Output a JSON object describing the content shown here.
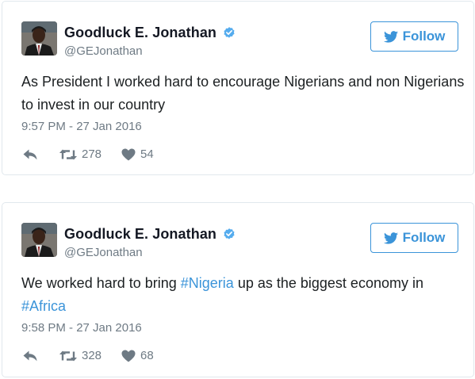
{
  "tweets": [
    {
      "display_name": "Goodluck E. Jonathan",
      "handle": "@GEJonathan",
      "follow_label": "Follow",
      "text_segments": [
        {
          "text": "As President I worked hard to encourage Nigerians and non Nigerians to invest in our country",
          "type": "text"
        }
      ],
      "timestamp": "9:57 PM - 27 Jan 2016",
      "retweets": "278",
      "likes": "54"
    },
    {
      "display_name": "Goodluck E. Jonathan",
      "handle": "@GEJonathan",
      "follow_label": "Follow",
      "text_segments": [
        {
          "text": "We worked hard to bring ",
          "type": "text"
        },
        {
          "text": "#Nigeria",
          "type": "hashtag"
        },
        {
          "text": " up as the biggest economy in ",
          "type": "text"
        },
        {
          "text": "#Africa",
          "type": "hashtag"
        }
      ],
      "timestamp": "9:58 PM - 27 Jan 2016",
      "retweets": "328",
      "likes": "68"
    }
  ],
  "colors": {
    "accent": "#3b94d9",
    "verified": "#55acee",
    "muted": "#6e7a84",
    "text": "#1c2022"
  },
  "icons": {
    "verified": "verified-badge-icon",
    "follow": "twitter-bird-icon",
    "reply": "reply-arrow-icon",
    "retweet": "retweet-icon",
    "like": "heart-icon"
  }
}
